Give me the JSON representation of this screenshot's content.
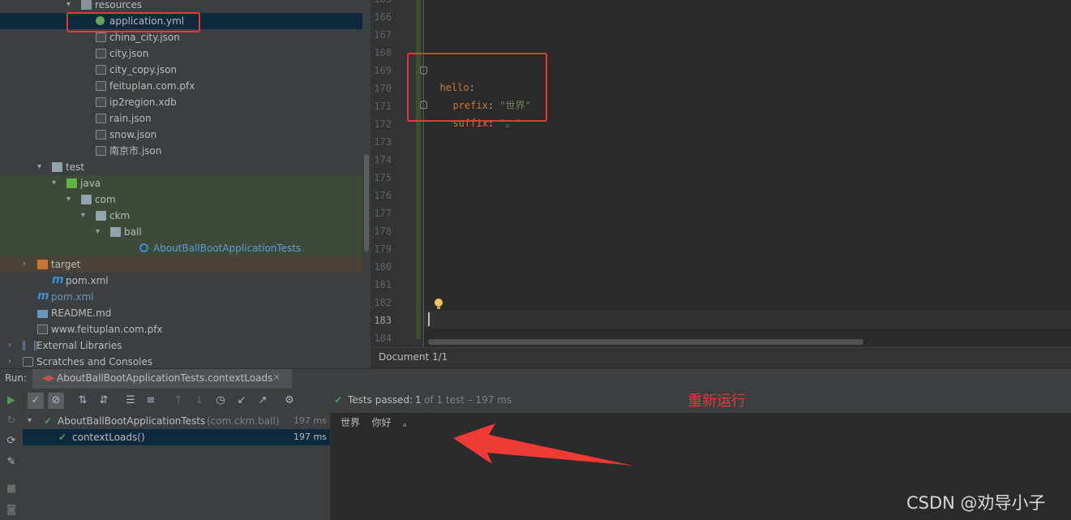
{
  "project_tree": {
    "rows": [
      {
        "label": "resources",
        "indent": 100,
        "arrow": "▾",
        "icon": "folder-blue"
      },
      {
        "label": "application.yml",
        "indent": 118,
        "arrow": "",
        "icon": "yml"
      },
      {
        "label": "china_city.json",
        "indent": 118,
        "arrow": "",
        "icon": "file"
      },
      {
        "label": "city.json",
        "indent": 118,
        "arrow": "",
        "icon": "file"
      },
      {
        "label": "city_copy.json",
        "indent": 118,
        "arrow": "",
        "icon": "file"
      },
      {
        "label": "feituplan.com.pfx",
        "indent": 118,
        "arrow": "",
        "icon": "file"
      },
      {
        "label": "ip2region.xdb",
        "indent": 118,
        "arrow": "",
        "icon": "file"
      },
      {
        "label": "rain.json",
        "indent": 118,
        "arrow": "",
        "icon": "file"
      },
      {
        "label": "snow.json",
        "indent": 118,
        "arrow": "",
        "icon": "file"
      },
      {
        "label": "南京市.json",
        "indent": 118,
        "arrow": "",
        "icon": "file"
      },
      {
        "label": "test",
        "indent": 64,
        "arrow": "▾",
        "icon": "folder"
      },
      {
        "label": "java",
        "indent": 82,
        "arrow": "▾",
        "icon": "folder-green"
      },
      {
        "label": "com",
        "indent": 100,
        "arrow": "▾",
        "icon": "folder"
      },
      {
        "label": "ckm",
        "indent": 118,
        "arrow": "▾",
        "icon": "folder"
      },
      {
        "label": "ball",
        "indent": 136,
        "arrow": "▾",
        "icon": "folder"
      },
      {
        "label": "AboutBallBootApplicationTests",
        "indent": 172,
        "arrow": "",
        "icon": "class"
      },
      {
        "label": "target",
        "indent": 46,
        "arrow": "›",
        "icon": "folder-orange"
      },
      {
        "label": "pom.xml",
        "indent": 64,
        "arrow": "",
        "icon": "maven"
      },
      {
        "label": "pom.xml",
        "indent": 46,
        "arrow": "",
        "icon": "maven"
      },
      {
        "label": "README.md",
        "indent": 46,
        "arrow": "",
        "icon": "md"
      },
      {
        "label": "www.feituplan.com.pfx",
        "indent": 46,
        "arrow": "",
        "icon": "file"
      },
      {
        "label": "External Libraries",
        "indent": 28,
        "arrow": "›",
        "icon": "lib"
      },
      {
        "label": "Scratches and Consoles",
        "indent": 28,
        "arrow": "›",
        "icon": "scratch"
      }
    ]
  },
  "editor": {
    "line_numbers": [
      "165",
      "166",
      "167",
      "168",
      "169",
      "170",
      "171",
      "172",
      "173",
      "174",
      "175",
      "176",
      "177",
      "178",
      "179",
      "180",
      "181",
      "182",
      "183",
      "184"
    ],
    "code": {
      "hello_key": "hello",
      "colon": ":",
      "prefix_key": "prefix",
      "prefix_value": "\"世界\"",
      "suffix_key": "suffix",
      "suffix_value": "\"。\""
    },
    "breadcrumb": "Document 1/1"
  },
  "run_panel": {
    "run_label": "Run:",
    "tab_label": "AboutBallBootApplicationTests.contextLoads",
    "status_passed": "Tests passed:",
    "status_count": "1",
    "status_rest": "of 1 test – 197 ms",
    "annotation": "重新运行",
    "tree": [
      {
        "label": "AboutBallBootApplicationTests",
        "package": "(com.ckm.ball)",
        "time": "197 ms"
      },
      {
        "label": "contextLoads()",
        "package": "",
        "time": "197 ms"
      }
    ],
    "console_output": "世界  你好  。"
  },
  "watermark": "CSDN @劝导小子",
  "colors": {
    "accent_red": "#e53935",
    "pass_green": "#499c54",
    "selection": "#0d293e"
  }
}
